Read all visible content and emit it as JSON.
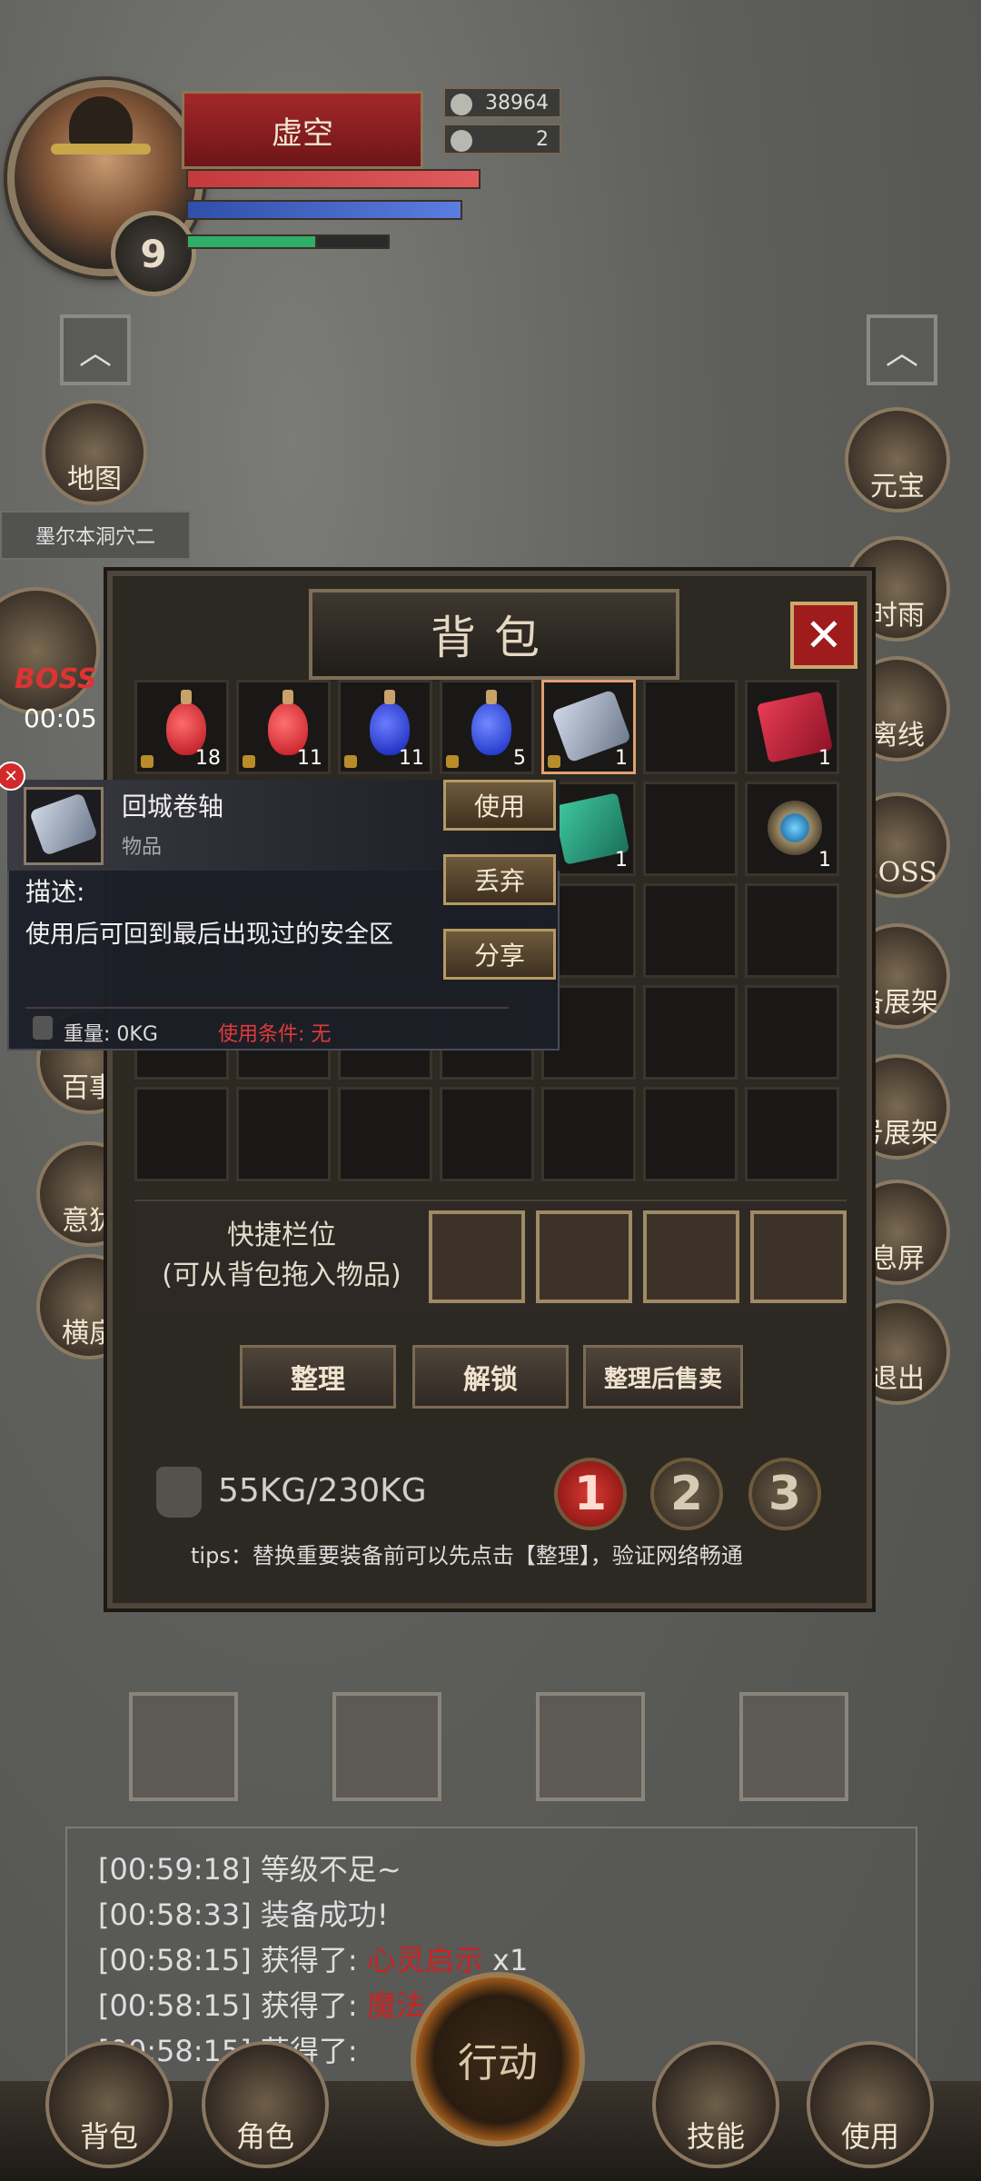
{
  "player": {
    "name": "虚空",
    "level": "9",
    "gold": "38964",
    "ingots": "2"
  },
  "left_side": {
    "map_label": "地图",
    "location": "墨尔本洞穴二",
    "boss_label": "BOSS",
    "timer": "00:05",
    "btn_hundred": "百事",
    "btn_yi": "意犹",
    "btn_heng": "横扇"
  },
  "right_side": {
    "yuanbao": "元宝",
    "shiyu": "时雨",
    "lixian": "离线",
    "boss": "BOSS",
    "zhanjia1": "备展架",
    "zhanjia2": "号展架",
    "xiping": "息屏",
    "tuichu": "退出"
  },
  "backpack": {
    "title": "背包",
    "close_icon": "close-icon",
    "items": [
      {
        "name": "red-potion-small",
        "count": "18",
        "color": "#d81e2a",
        "locked": true
      },
      {
        "name": "red-potion-large",
        "count": "11",
        "color": "#e02a32",
        "locked": true
      },
      {
        "name": "blue-potion-small",
        "count": "11",
        "color": "#2238d8",
        "locked": true
      },
      {
        "name": "blue-potion-large",
        "count": "5",
        "color": "#2a48e0",
        "locked": true
      },
      {
        "name": "town-portal-scroll",
        "count": "1",
        "locked": true
      },
      {
        "name": "empty",
        "count": ""
      },
      {
        "name": "red-book",
        "count": "1"
      },
      {
        "name": "hidden-slot",
        "count": ""
      },
      {
        "name": "hidden-slot",
        "count": ""
      },
      {
        "name": "hidden-slot",
        "count": ""
      },
      {
        "name": "hidden-slot",
        "count": ""
      },
      {
        "name": "green-book",
        "count": "1"
      },
      {
        "name": "empty",
        "count": ""
      },
      {
        "name": "sapphire-ring",
        "count": "1"
      }
    ],
    "quickbar_label": "快捷栏位",
    "quickbar_hint": "(可从背包拖入物品)",
    "buttons": {
      "sort": "整理",
      "unlock": "解锁",
      "sort_sell": "整理后售卖"
    },
    "weight": "55KG/230KG",
    "pages": [
      "1",
      "2",
      "3"
    ],
    "tips": "tips：替换重要装备前可以先点击【整理】，验证网络畅通"
  },
  "tooltip": {
    "item_name": "回城卷轴",
    "item_type": "物品",
    "btn_use": "使用",
    "btn_discard": "丢弃",
    "btn_share": "分享",
    "desc_label": "描述:",
    "desc_text": "使用后可回到最后出现过的安全区",
    "weight": "重量: 0KG",
    "condition": "使用条件: 无"
  },
  "chat": [
    {
      "time": "[00:59:18]",
      "text": "等级不足~",
      "item": "",
      "suffix": ""
    },
    {
      "time": "[00:58:33]",
      "text": "装备成功!",
      "item": "",
      "suffix": ""
    },
    {
      "time": "[00:58:15]",
      "text": "获得了:",
      "item": "心灵启示",
      "suffix": "x1"
    },
    {
      "time": "[00:58:15]",
      "text": "获得了:",
      "item": "魔法",
      "suffix": ""
    },
    {
      "time": "[00:58:15]",
      "text": "获得了:",
      "item": "",
      "suffix": ""
    }
  ],
  "bottom_nav": {
    "bag": "背包",
    "role": "角色",
    "action": "行动",
    "skill": "技能",
    "use": "使用"
  }
}
